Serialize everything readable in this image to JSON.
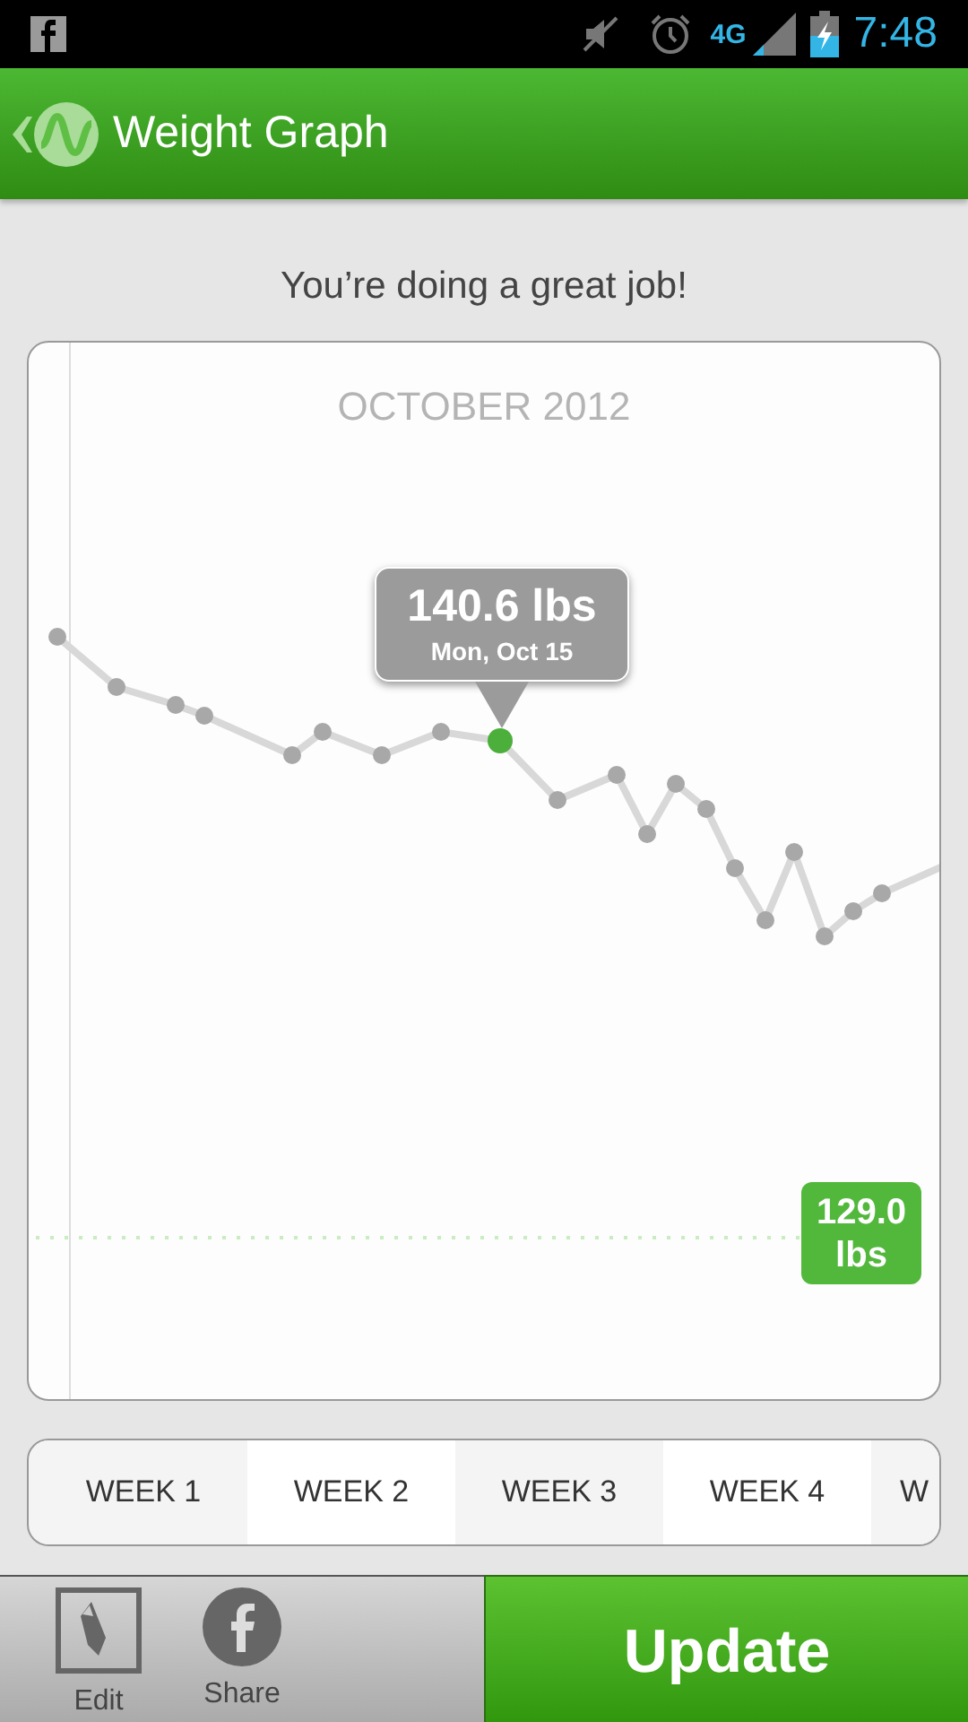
{
  "status_bar": {
    "time": "7:48",
    "network": "4G"
  },
  "app_bar": {
    "title": "Weight Graph"
  },
  "message": "You’re doing a great job!",
  "graph": {
    "month": "OCTOBER 2012",
    "tooltip": {
      "weight": "140.6 lbs",
      "date": "Mon, Oct 15"
    },
    "goal": {
      "value": "129.0",
      "unit": "lbs"
    }
  },
  "week_tabs": [
    {
      "label": "WEEK 1"
    },
    {
      "label": "WEEK 2"
    },
    {
      "label": "WEEK 3"
    },
    {
      "label": "WEEK 4"
    },
    {
      "label": "W"
    }
  ],
  "bottom_bar": {
    "actions": [
      {
        "kind": "edit",
        "label": "Edit"
      },
      {
        "kind": "share",
        "label": "Share"
      }
    ],
    "primary": "Update"
  }
}
